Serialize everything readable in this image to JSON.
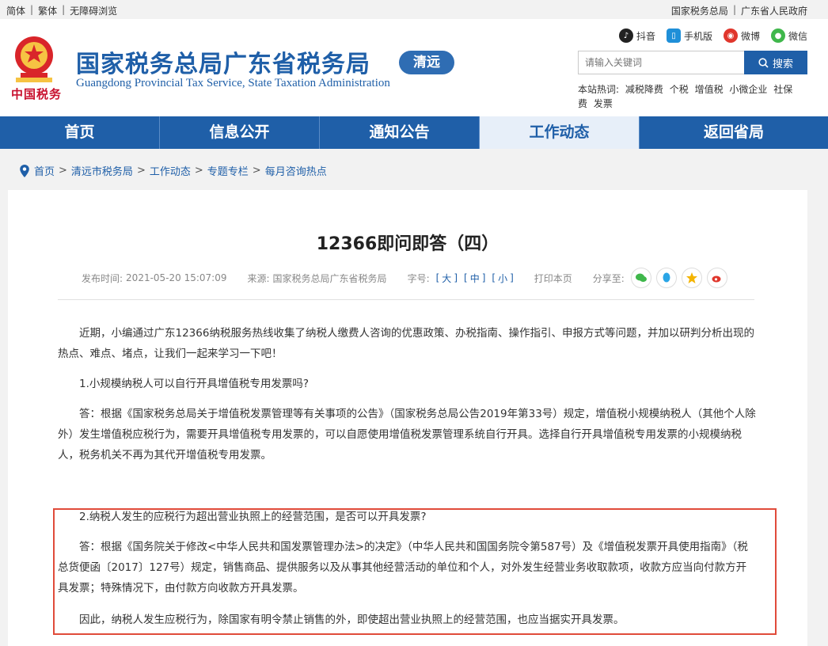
{
  "topbar": {
    "links_left": [
      "简体",
      "繁体",
      "无障碍浏览"
    ],
    "links_right": [
      "国家税务总局",
      "广东省人民政府"
    ]
  },
  "header": {
    "emblem_text": "中国税务",
    "title": "国家税务总局广东省税务局",
    "subtitle": "Guangdong Provincial Tax Service, State Taxation Administration",
    "city": "清远",
    "social": [
      {
        "label": "抖音",
        "icon": "tiktok-icon",
        "color": "#222222"
      },
      {
        "label": "手机版",
        "icon": "mobile-icon",
        "color": "#1f8fd8"
      },
      {
        "label": "微博",
        "icon": "weibo-icon",
        "color": "#e0362c"
      },
      {
        "label": "微信",
        "icon": "wechat-icon",
        "color": "#3fb74b"
      }
    ],
    "search_placeholder": "请输入关键词",
    "search_button": "搜索",
    "hot_label": "本站热词:",
    "hot_words": [
      "减税降费",
      "个税",
      "增值税",
      "小微企业",
      "社保费",
      "发票"
    ]
  },
  "nav": {
    "tabs": [
      "首页",
      "信息公开",
      "通知公告",
      "工作动态",
      "返回省局"
    ],
    "active": "工作动态"
  },
  "breadcrumb": [
    "首页",
    "清远市税务局",
    "工作动态",
    "专题专栏",
    "每月咨询热点"
  ],
  "article": {
    "title": "12366即问即答（四）",
    "publish_label": "发布时间:",
    "publish_time": "2021-05-20 15:07:09",
    "source_label": "来源:",
    "source": "国家税务总局广东省税务局",
    "font_label": "字号:",
    "font_large": "大",
    "font_medium": "中",
    "font_small": "小",
    "print": "打印本页",
    "share_label": "分享至:",
    "paragraphs": [
      "近期，小编通过广东12366纳税服务热线收集了纳税人缴费人咨询的优惠政策、办税指南、操作指引、申报方式等问题，并加以研判分析出现的热点、难点、堵点，让我们一起来学习一下吧！",
      "1.小规模纳税人可以自行开具增值税专用发票吗?",
      "答：根据《国家税务总局关于增值税发票管理等有关事项的公告》（国家税务总局公告2019年第33号）规定，增值税小规模纳税人（其他个人除外）发生增值税应税行为，需要开具增值税专用发票的，可以自愿使用增值税发票管理系统自行开具。选择自行开具增值税专用发票的小规模纳税人，税务机关不再为其代开增值税专用发票。",
      "2.纳税人发生的应税行为超出营业执照上的经营范围，是否可以开具发票?",
      "答：根据《国务院关于修改<中华人民共和国发票管理办法>的决定》（中华人民共和国国务院令第587号）及《增值税发票开具使用指南》（税总货便函〔2017〕127号）规定，销售商品、提供服务以及从事其他经营活动的单位和个人，对外发生经营业务收取款项，收款方应当向付款方开具发票；特殊情况下，由付款方向收款方开具发票。",
      "因此，纳税人发生应税行为，除国家有明令禁止销售的外，即使超出营业执照上的经营范围，也应当据实开具发票。"
    ]
  },
  "colors": {
    "brand_blue": "#1f5fa8",
    "highlight_red": "#e04b3a"
  }
}
